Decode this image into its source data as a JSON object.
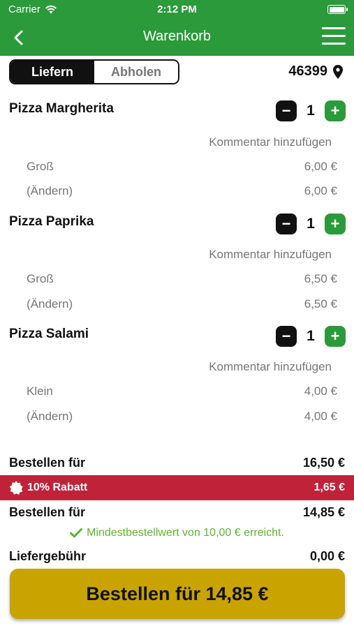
{
  "status_bar": {
    "carrier": "Carrier",
    "time": "2:12 PM"
  },
  "nav": {
    "title": "Warenkorb",
    "back_icon": "chevron-left-icon",
    "menu_icon": "hamburger-menu-icon"
  },
  "delivery_mode": {
    "options": [
      "Liefern",
      "Abholen"
    ],
    "selected": "Liefern"
  },
  "postal_code": "46399",
  "items": [
    {
      "name": "Pizza Margherita",
      "quantity": "1",
      "comment_label": "Kommentar hinzufügen",
      "size": "Groß",
      "size_price": "6,00 €",
      "change_label": "(Ändern)",
      "change_price": "6,00 €"
    },
    {
      "name": "Pizza Paprika",
      "quantity": "1",
      "comment_label": "Kommentar hinzufügen",
      "size": "Groß",
      "size_price": "6,50 €",
      "change_label": "(Ändern)",
      "change_price": "6,50 €"
    },
    {
      "name": "Pizza Salami",
      "quantity": "1",
      "comment_label": "Kommentar hinzufügen",
      "size": "Klein",
      "size_price": "4,00 €",
      "change_label": "(Ändern)",
      "change_price": "4,00 €"
    }
  ],
  "summary": {
    "subtotal_label": "Bestellen für",
    "subtotal_value": "16,50 €",
    "discount_label": "10% Rabatt",
    "discount_value": "1,65 €",
    "total_label": "Bestellen für",
    "total_value": "14,85 €",
    "minimum_message": "Mindestbestellwert von 10,00 € erreicht.",
    "delivery_fee_label": "Liefergebühr",
    "delivery_fee_value": "0,00 €"
  },
  "order_button_label": "Bestellen für 14,85 €",
  "colors": {
    "brand_green": "#2a9a3a",
    "discount_red": "#c0223a",
    "order_gold": "#c9a400",
    "success_green": "#5cb531"
  }
}
